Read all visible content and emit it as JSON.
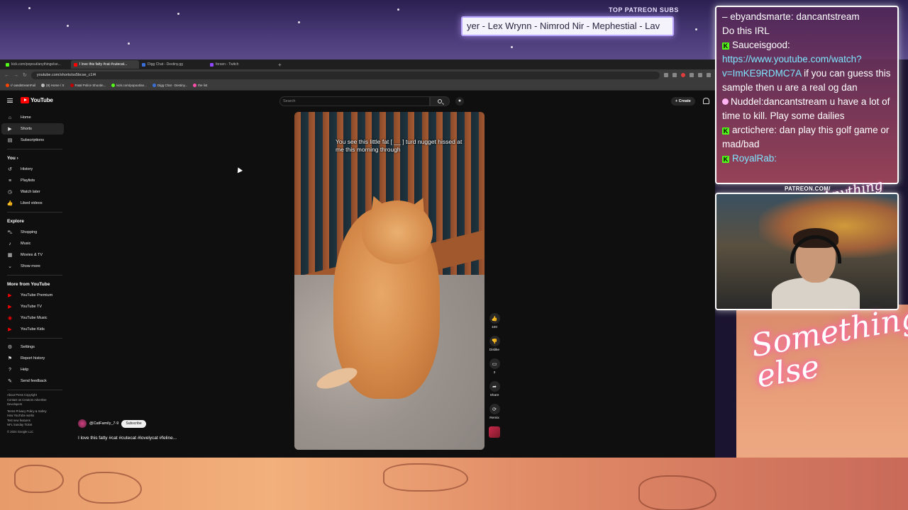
{
  "overlay": {
    "patreon_title": "TOP PATREON SUBS",
    "ticker_text": "yer - Lex Wrynn - Nimrod Nir - Mephestial - Lav",
    "patreon_url": "PATREON.COM/",
    "signature_small": "Anything else",
    "signature_big": "Something else"
  },
  "chat": {
    "messages": [
      {
        "user": "ebyandsmarte: dancantstream",
        "text": ""
      },
      {
        "user": "",
        "text": "Do this IRL"
      },
      {
        "user": "Sauceisgood:",
        "text": "",
        "link": "https://www.youtube.com/watch?v=ImKE9RDMC7A",
        "after": " if you can guess this sample then u are a real og dan"
      },
      {
        "user": "Nuddel:",
        "text": "dancantstream u have a lot of time to kill. Play some dailies"
      },
      {
        "user": "arctichere:",
        "text": "dan play this golf game or mad/bad"
      },
      {
        "user": "RoyalRab:",
        "text": ""
      }
    ]
  },
  "browser": {
    "tabs": [
      {
        "label": "kick.com/popout/anythingelse...",
        "color": "#53fc18",
        "active": false
      },
      {
        "label": "I love this fatty #cat #cutecat...",
        "color": "#ff0000",
        "active": true
      },
      {
        "label": "Digg Chat - Destiny.gg",
        "color": "#3b6fd8",
        "active": false
      },
      {
        "label": "forsen - Twitch",
        "color": "#9146ff",
        "active": false
      }
    ],
    "url": "youtube.com/shorts/ss5bcse_c1I4",
    "bookmarks": [
      {
        "label": "r/ oandstreamFail",
        "color": "#ff4500"
      },
      {
        "label": "(9) Home / X",
        "color": "#bbbbbb"
      },
      {
        "label": "Fatal Police Shootin...",
        "color": "#c00000"
      },
      {
        "label": "kick.com/popout/an...",
        "color": "#53fc18"
      },
      {
        "label": "Digg Chat - Destiny...",
        "color": "#3b6fd8"
      },
      {
        "label": "the list",
        "color": "#ff4fa8"
      }
    ]
  },
  "youtube": {
    "logo_text": "YouTube",
    "search_placeholder": "Search",
    "create_label": "Create",
    "sidebar": {
      "main": [
        {
          "label": "Home",
          "icon": "home-icon",
          "glyph": "⌂"
        },
        {
          "label": "Shorts",
          "icon": "shorts-icon",
          "glyph": "▶",
          "active": true
        },
        {
          "label": "Subscriptions",
          "icon": "subscriptions-icon",
          "glyph": "▤"
        }
      ],
      "you_heading": "You",
      "you": [
        {
          "label": "History",
          "icon": "history-icon",
          "glyph": "↺"
        },
        {
          "label": "Playlists",
          "icon": "playlists-icon",
          "glyph": "≡"
        },
        {
          "label": "Watch later",
          "icon": "watch-later-icon",
          "glyph": "◷"
        },
        {
          "label": "Liked videos",
          "icon": "liked-videos-icon",
          "glyph": "👍"
        }
      ],
      "explore_heading": "Explore",
      "explore": [
        {
          "label": "Shopping",
          "icon": "shopping-icon",
          "glyph": "⛍"
        },
        {
          "label": "Music",
          "icon": "music-icon",
          "glyph": "♪"
        },
        {
          "label": "Movies & TV",
          "icon": "movies-icon",
          "glyph": "▦"
        },
        {
          "label": "Show more",
          "icon": "chevron-down-icon",
          "glyph": "⌄"
        }
      ],
      "more_heading": "More from YouTube",
      "more": [
        {
          "label": "YouTube Premium",
          "icon": "youtube-premium-icon",
          "glyph": "▶"
        },
        {
          "label": "YouTube TV",
          "icon": "youtube-tv-icon",
          "glyph": "▶"
        },
        {
          "label": "YouTube Music",
          "icon": "youtube-music-icon",
          "glyph": "◉"
        },
        {
          "label": "YouTube Kids",
          "icon": "youtube-kids-icon",
          "glyph": "▶"
        }
      ],
      "settings": [
        {
          "label": "Settings",
          "icon": "gear-icon",
          "glyph": "⚙"
        },
        {
          "label": "Report history",
          "icon": "flag-icon",
          "glyph": "⚑"
        },
        {
          "label": "Help",
          "icon": "help-icon",
          "glyph": "?"
        },
        {
          "label": "Send feedback",
          "icon": "feedback-icon",
          "glyph": "✎"
        }
      ],
      "footer_1": "About  Press  Copyright",
      "footer_2": "Contact us  Creators  Advertise",
      "footer_3": "Developers",
      "footer_4": "Terms  Privacy  Policy & Safety",
      "footer_5": "How YouTube works",
      "footer_6": "Test new features",
      "footer_7": "NFL Sunday Ticket",
      "footer_8": "© 2024 Google LLC"
    },
    "short": {
      "caption": "You see this little fat [ __ ] turd nugget hissed at me this morning through",
      "channel": "@CatFamily_7-9",
      "subscribe_label": "Subscribe",
      "title": "I love this fatty #cat #cutecat #lovelycat #feline...",
      "like_count": "100",
      "dislike_label": "Dislike",
      "comment_count": "3",
      "share_label": "Share",
      "remix_label": "Remix"
    }
  }
}
